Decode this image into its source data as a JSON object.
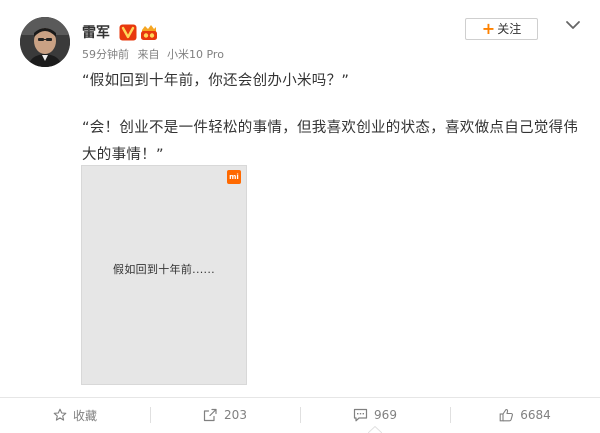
{
  "author": {
    "name": "雷军",
    "avatar_icon": "avatar-photo",
    "vip_badge_icon": "verified-v-badge",
    "fan_badge_icon": "fan-club-badge"
  },
  "meta": {
    "time": "59分钟前",
    "from_label": "来自",
    "device": "小米10 Pro"
  },
  "follow_button": {
    "icon": "+",
    "label": "关注"
  },
  "more_menu_icon": "chevron-down-icon",
  "post": {
    "paragraphs": [
      "“假如回到十年前，你还会创办小米吗？”",
      "“会！创业不是一件轻松的事情，但我喜欢创业的状态，喜欢做点自己觉得伟大的事情！”"
    ]
  },
  "media": {
    "logo_text": "mi",
    "caption": "假如回到十年前......"
  },
  "actions": {
    "favorite": {
      "label": "收藏",
      "icon": "star-icon"
    },
    "repost": {
      "count": "203",
      "icon": "repost-icon"
    },
    "comment": {
      "count": "969",
      "icon": "comment-icon"
    },
    "like": {
      "count": "6684",
      "icon": "thumbs-up-icon"
    }
  },
  "colors": {
    "accent_orange": "#ff8200",
    "mi_orange": "#ff6900",
    "vip_red": "#e8380d",
    "text_primary": "#333333",
    "text_secondary": "#808080",
    "image_bg": "#e6e6e6"
  }
}
